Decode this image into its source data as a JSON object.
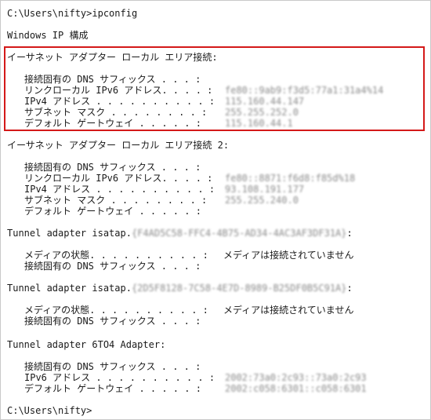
{
  "prompt_start": "C:\\Users\\nifty>ipconfig",
  "config_title": "Windows IP 構成",
  "adapters": [
    {
      "header": "イーサネット アダプター ローカル エリア接続:",
      "rows": [
        {
          "label": "接続固有の DNS サフィックス . . . :",
          "value": ""
        },
        {
          "label": "リンクローカル IPv6 アドレス. . . . :",
          "value": "fe80::9ab9:f3d5:77a1:31a4%14"
        },
        {
          "label": "IPv4 アドレス . . . . . . . . . . :",
          "value": "115.160.44.147"
        },
        {
          "label": "サブネット マスク . . . . . . . . :",
          "value": "255.255.252.0"
        },
        {
          "label": "デフォルト ゲートウェイ . . . . . :",
          "value": "115.160.44.1"
        }
      ]
    },
    {
      "header": "イーサネット アダプター ローカル エリア接続 2:",
      "rows": [
        {
          "label": "接続固有の DNS サフィックス . . . :",
          "value": ""
        },
        {
          "label": "リンクローカル IPv6 アドレス. . . . :",
          "value": "fe80::8871:f6d8:f85d%18"
        },
        {
          "label": "IPv4 アドレス . . . . . . . . . . :",
          "value": "93.108.191.177"
        },
        {
          "label": "サブネット マスク . . . . . . . . :",
          "value": "255.255.240.0"
        },
        {
          "label": "デフォルト ゲートウェイ . . . . . :",
          "value": ""
        }
      ]
    },
    {
      "header": "Tunnel adapter isatap.",
      "header_guid": "{F4AD5C58-FFC4-4B75-AD34-4AC3AF3DF31A}",
      "header_suffix": ":",
      "rows": [
        {
          "label": "メディアの状態. . . . . . . . . . :",
          "value": "メディアは接続されていません"
        },
        {
          "label": "接続固有の DNS サフィックス . . . :",
          "value": ""
        }
      ]
    },
    {
      "header": "Tunnel adapter isatap.",
      "header_guid": "{2D5F8128-7C58-4E7D-8989-B25DF0B5C91A}",
      "header_suffix": ":",
      "rows": [
        {
          "label": "メディアの状態. . . . . . . . . . :",
          "value": "メディアは接続されていません"
        },
        {
          "label": "接続固有の DNS サフィックス . . . :",
          "value": ""
        }
      ]
    },
    {
      "header": "Tunnel adapter 6TO4 Adapter:",
      "rows": [
        {
          "label": "接続固有の DNS サフィックス . . . :",
          "value": ""
        },
        {
          "label": "IPv6 アドレス . . . . . . . . . . :",
          "value": "2002:73a0:2c93::73a0:2c93"
        },
        {
          "label": "デフォルト ゲートウェイ . . . . . :",
          "value": "2002:c058:6301::c058:6301"
        }
      ]
    }
  ],
  "prompt_end": "C:\\Users\\nifty>",
  "highlight_color": "#d41919"
}
